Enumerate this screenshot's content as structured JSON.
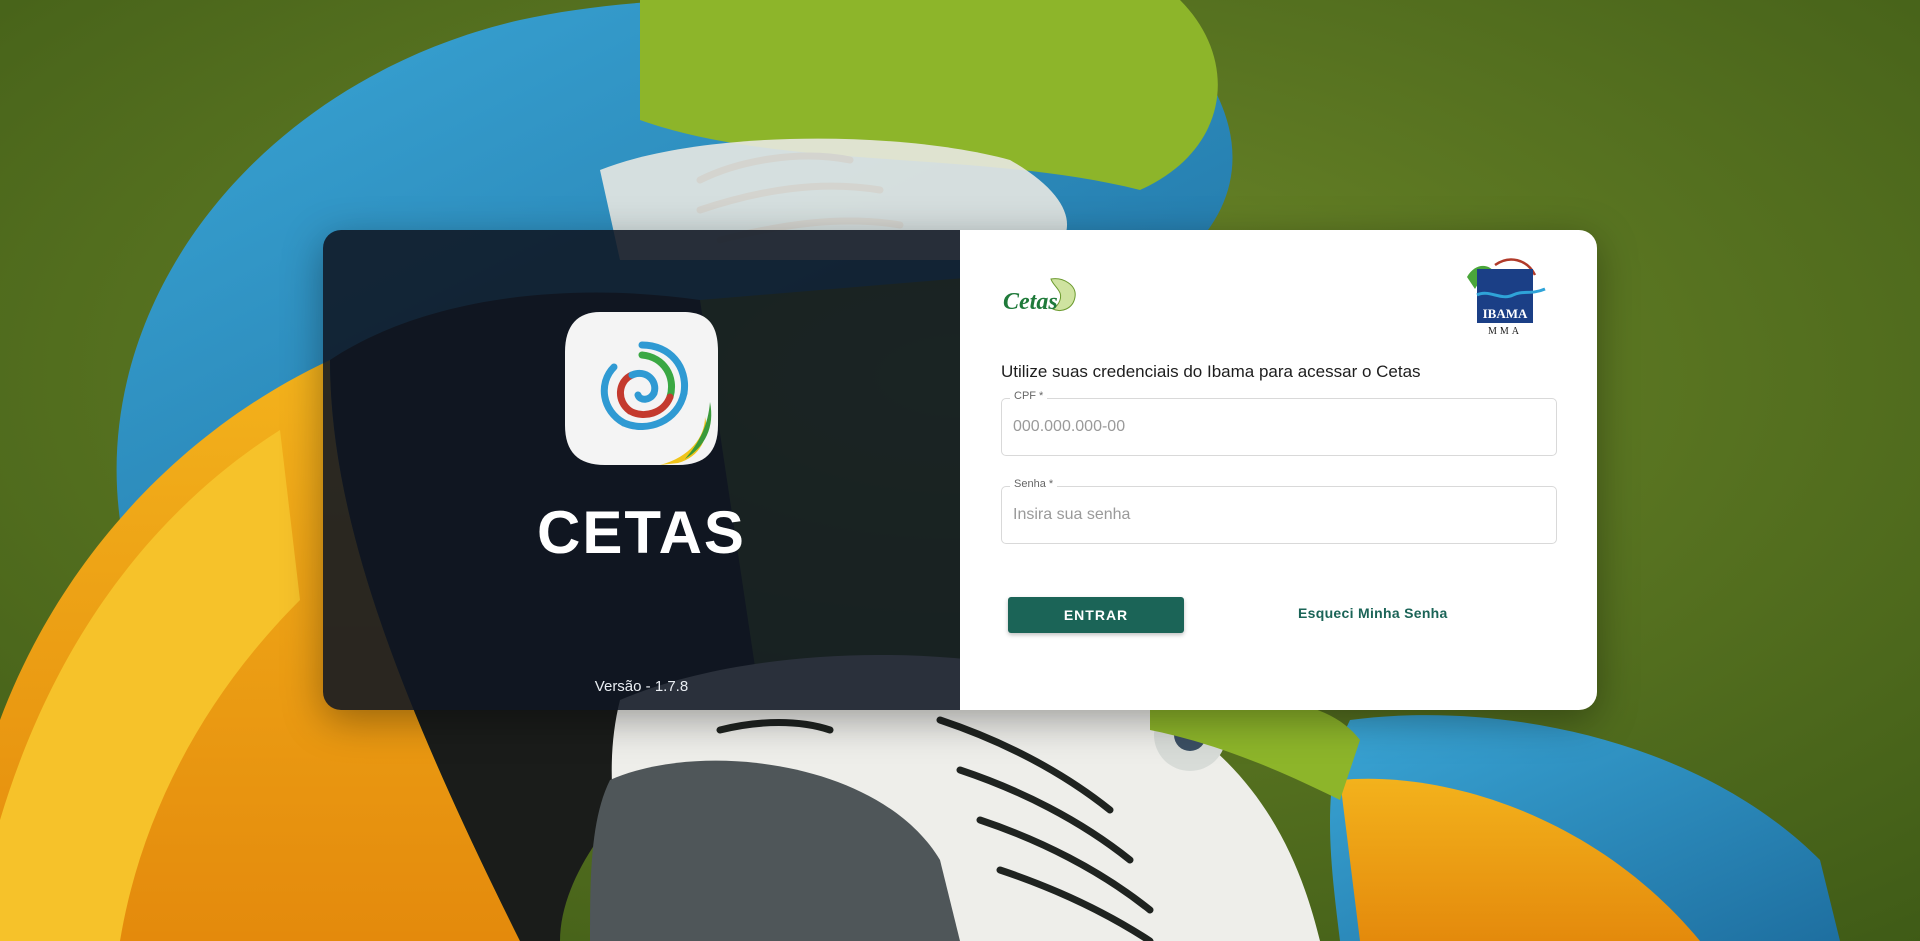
{
  "brand": {
    "app_name": "CETAS",
    "version": "Versão - 1.7.8"
  },
  "logos": {
    "cetas_logo_text": "Cetas",
    "ibama_logo_text": "IBAMA",
    "ibama_logo_subtext": "MMA"
  },
  "login": {
    "intro": "Utilize suas credenciais do Ibama para acessar o Cetas",
    "cpf_label": "CPF *",
    "cpf_placeholder": "000.000.000-00",
    "cpf_value": "",
    "senha_label": "Senha *",
    "senha_placeholder": "Insira sua senha",
    "senha_value": "",
    "submit_label": "ENTRAR",
    "forgot_label": "Esqueci Minha Senha"
  },
  "colors": {
    "primary": "#1b6457",
    "brand_panel": "#0f1622",
    "card_bg": "#ffffff"
  },
  "icons": [
    "app-spiral-icon",
    "cetas-logo",
    "ibama-logo"
  ]
}
